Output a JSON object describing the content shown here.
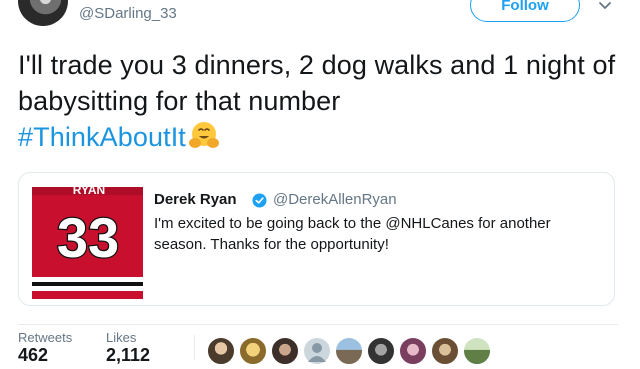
{
  "author": {
    "handle": "@SDarling_33",
    "follow_label": "Follow",
    "avatar_icon": "user-avatar-icon"
  },
  "tweet": {
    "text": "I'll trade you 3 dinners, 2 dog walks and 1 night of babysitting for that number",
    "hashtag": "#ThinkAboutIt",
    "emoji_icon": "hugging-face-emoji"
  },
  "quoted_tweet": {
    "name": "Derek Ryan",
    "handle": "@DerekAllenRyan",
    "body": "I'm excited to be going back to the @NHLCanes for another season. Thanks for the opportunity!",
    "image_text": {
      "name_on_jersey": "RYAN",
      "number": "33"
    }
  },
  "stats": {
    "retweets_label": "Retweets",
    "retweets_value": "462",
    "likes_label": "Likes",
    "likes_value": "2,112"
  },
  "colors": {
    "accent": "#1da1f2",
    "hashtag": "#1b95e0",
    "jersey_red": "#c8102e"
  }
}
